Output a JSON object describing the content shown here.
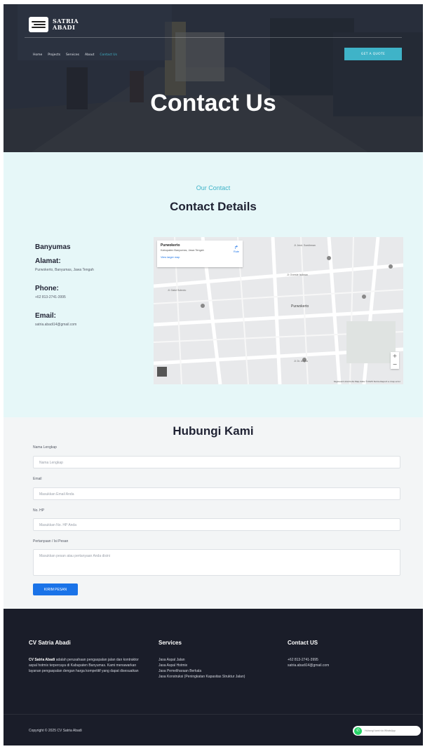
{
  "header": {
    "logo_line1": "SATRIA",
    "logo_line2": "ABADI",
    "nav": [
      "Home",
      "Projects",
      "Services",
      "About",
      "Contact Us"
    ],
    "quote_button": "GET A QUOTE",
    "hero_title": "Contact Us"
  },
  "contact": {
    "eyebrow": "Our Contact",
    "title": "Contact Details",
    "city": "Banyumas",
    "address_label": "Alamat:",
    "address_value": "Purwokerto, Banyumas, Jawa Tengah",
    "phone_label": "Phone:",
    "phone_value": "+62 813-2741-3995",
    "email_label": "Email:",
    "email_value": "satria.abadi14@gmail.com"
  },
  "map": {
    "place_title": "Purwokerto",
    "place_sub": "Kabupaten Banyumas, Jawa Tengah",
    "larger_map": "View larger map",
    "route": "Rute",
    "zoom_in": "+",
    "zoom_out": "−",
    "footer": "Keyboard shortcuts   Map data ©2025   Terms   Report a map error",
    "labels": [
      "Purwokerto",
      "Jl. Jend. Soedirman",
      "Jl. Gatot Subroto",
      "Jl. Overste Isdiman",
      "Jl. Dr. Angka"
    ]
  },
  "form": {
    "title": "Hubungi Kami",
    "name_label": "Nama Lengkap",
    "name_placeholder": "Nama Lengkap",
    "email_label": "Email",
    "email_placeholder": "Masukkan Email Anda",
    "phone_label": "No. HP",
    "phone_placeholder": "Masukkan No. HP Anda",
    "message_label": "Pertanyaan / Isi Pesan",
    "message_placeholder": "Masukkan pesan atau pertanyaan Anda disini",
    "submit": "KIRIM PESAN"
  },
  "footer": {
    "col1_title": "CV Satria Abadi",
    "col1_brand": "CV Satria Abadi",
    "col1_text": "adalah perusahaan pengaspalan jalan dan kontraktor aspal hotmix terpercaya di Kabupaten Banyumas. Kami menawarkan layanan pengaspalan dengan harga kompetitif yang dapat disesuaikan",
    "col2_title": "Services",
    "services": [
      "Jasa Aspal Jalan",
      "Jasa Aspal Hotmix",
      "Jasa Pemeliharaan Berkala",
      "Jasa Konstruksi (Peningkatan Kapasitas Struktur Jalan)"
    ],
    "col3_title": "Contact US",
    "phone": "+62 813-2741-3995",
    "email": "satria.abadi14@gmail.com",
    "copyright": "Copyright © 2025 CV Satria Abadi",
    "whatsapp": "Hubungi kami via WhatsApp"
  },
  "colors": {
    "accent": "#3fb3c8",
    "button_blue": "#1a73e8",
    "footer_bg": "#1a1d29",
    "details_bg": "#e6f7f8"
  }
}
